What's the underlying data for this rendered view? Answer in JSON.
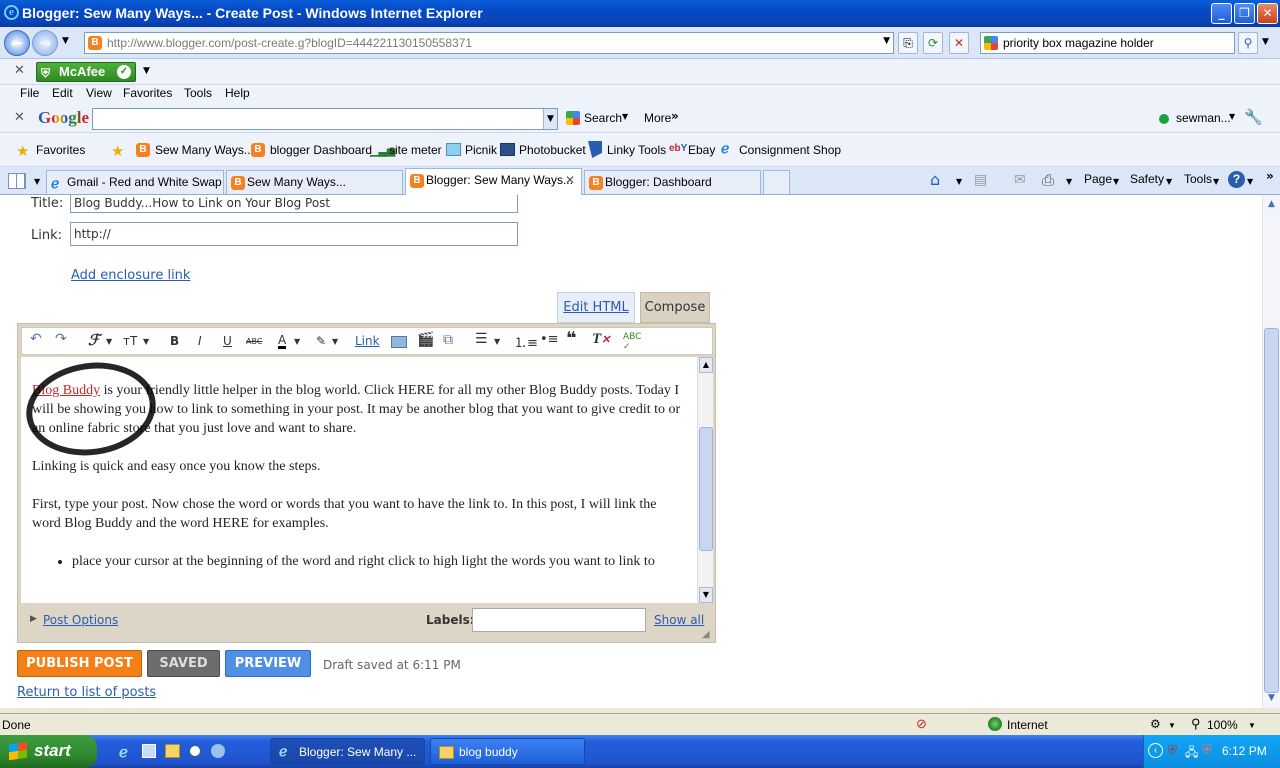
{
  "window": {
    "title": "Blogger: Sew Many Ways... - Create Post - Windows Internet Explorer"
  },
  "address": {
    "url": "http://www.blogger.com/post-create.g?blogID=444221130150558371",
    "search_text": "priority box magazine holder"
  },
  "mcafee": {
    "label": "McAfee"
  },
  "menu": [
    "File",
    "Edit",
    "View",
    "Favorites",
    "Tools",
    "Help"
  ],
  "google_bar": {
    "logo": "Google",
    "search_label": "Search",
    "more_label": "More",
    "account": "sewman..."
  },
  "favorites": {
    "favorites_label": "Favorites",
    "items": [
      "Sew Many Ways..",
      "blogger Dashboard",
      "site meter",
      "Picnik",
      "Photobucket",
      "Linky Tools",
      "Ebay",
      "Consignment Shop"
    ]
  },
  "tabs": [
    "Gmail - Red and White Swap ...",
    "Sew Many Ways...",
    "Blogger: Sew Many Ways...",
    "Blogger: Dashboard"
  ],
  "commands": {
    "page": "Page",
    "safety": "Safety",
    "tools": "Tools"
  },
  "post": {
    "title_label": "Title:",
    "title_value": "Blog Buddy...How to Link on Your Blog Post",
    "link_label": "Link:",
    "link_value": "http://",
    "add_enclosure": "Add enclosure link",
    "edit_html_tab": "Edit HTML",
    "compose_tab": "Compose",
    "toolbar_link": "Link",
    "body": {
      "p1_link": "Blog Buddy",
      "p1_rest": " is your friendly little helper in the blog world. Click HERE for all my other Blog Buddy posts. Today I will be showing you how to link to something in your post. It may be another blog that you want to give credit to or an online fabric store that you just love and want to share.",
      "p2": "Linking is quick and easy once you know the steps.",
      "p3": "First, type your post. Now chose the word or words that you want to have the link to. In this post, I will link the word Blog Buddy and the word HERE for examples.",
      "li1": "place your cursor at the beginning of the word and right click to high light the words you want to link to"
    },
    "post_options": "Post Options",
    "labels_label": "Labels:",
    "show_all": "Show all",
    "publish": "PUBLISH POST",
    "saved": "SAVED",
    "preview": "PREVIEW",
    "draft_status": "Draft saved at 6:11 PM",
    "return_link": "Return to list of posts"
  },
  "status_bar": {
    "left": "Done",
    "zone": "Internet",
    "zoom": "100%"
  },
  "taskbar": {
    "start": "start",
    "tasks": [
      "Blogger: Sew Many ...",
      "blog buddy"
    ],
    "clock": "6:12 PM"
  },
  "colors": {
    "publish": "#f57f17",
    "saved": "#6d6d6d",
    "preview": "#4f8fe6",
    "link": "#2a5db0",
    "annotation_link": "#c00000"
  }
}
